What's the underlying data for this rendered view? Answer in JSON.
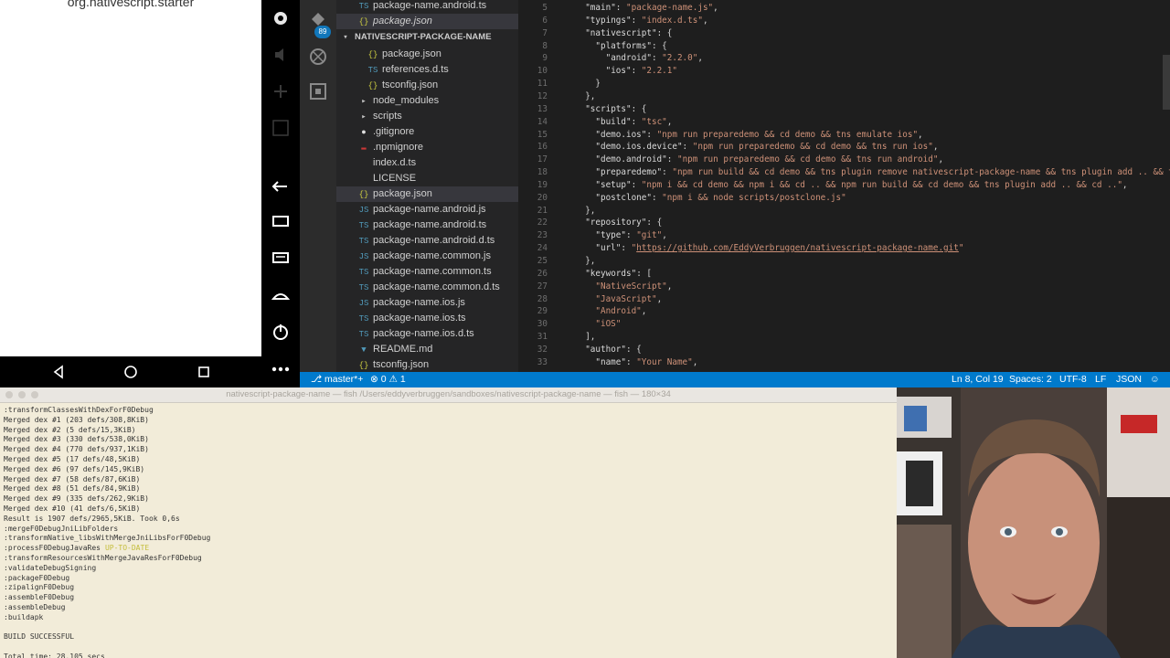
{
  "emulator": {
    "app_title": "org.nativescript.starter",
    "nav_icons": [
      "back-icon",
      "home-icon",
      "recents-icon",
      "more-icon"
    ],
    "side_icons": [
      "power-icon",
      "volume-up-icon",
      "volume-down-icon",
      "rotate-icon",
      "screenshot-icon",
      "zoom-icon",
      "back-icon",
      "overview-icon",
      "menu-icon",
      "home-icon",
      "power-icon",
      "more-icon"
    ]
  },
  "activity_bar": {
    "items": [
      "explorer-icon",
      "search-icon",
      "git-icon",
      "debug-icon",
      "extensions-icon"
    ],
    "git_badge": "89"
  },
  "explorer": {
    "items": [
      {
        "label": "package-name.android.ts",
        "icon": "TS",
        "kind": "ts",
        "indent": 1,
        "selected": false
      },
      {
        "label": "package.json",
        "icon": "{}",
        "kind": "json",
        "indent": 1,
        "selected": true,
        "italic": true
      },
      {
        "label": "NATIVESCRIPT-PACKAGE-NAME",
        "icon": "▾",
        "kind": "chev",
        "indent": 0,
        "selected": false,
        "header": true
      },
      {
        "label": "package.json",
        "icon": "{}",
        "kind": "json",
        "indent": 2,
        "selected": false
      },
      {
        "label": "references.d.ts",
        "icon": "TS",
        "kind": "ts",
        "indent": 2,
        "selected": false
      },
      {
        "label": "tsconfig.json",
        "icon": "{}",
        "kind": "json",
        "indent": 2,
        "selected": false
      },
      {
        "label": "node_modules",
        "icon": "▸",
        "kind": "chev",
        "indent": 1,
        "selected": false
      },
      {
        "label": "scripts",
        "icon": "▸",
        "kind": "chev",
        "indent": 1,
        "selected": false
      },
      {
        "label": ".gitignore",
        "icon": "●",
        "kind": "git",
        "indent": 1,
        "selected": false
      },
      {
        "label": ".npmignore",
        "icon": "▬",
        "kind": "npm",
        "indent": 1,
        "selected": false
      },
      {
        "label": "index.d.ts",
        "icon": "",
        "kind": "ts",
        "indent": 1,
        "selected": false
      },
      {
        "label": "LICENSE",
        "icon": "",
        "kind": "ts",
        "indent": 1,
        "selected": false
      },
      {
        "label": "package.json",
        "icon": "{}",
        "kind": "json",
        "indent": 1,
        "selected": true
      },
      {
        "label": "package-name.android.js",
        "icon": "JS",
        "kind": "js",
        "indent": 1,
        "selected": false
      },
      {
        "label": "package-name.android.ts",
        "icon": "TS",
        "kind": "ts",
        "indent": 1,
        "selected": false
      },
      {
        "label": "package-name.android.d.ts",
        "icon": "TS",
        "kind": "ts",
        "indent": 1,
        "selected": false
      },
      {
        "label": "package-name.common.js",
        "icon": "JS",
        "kind": "js",
        "indent": 1,
        "selected": false
      },
      {
        "label": "package-name.common.ts",
        "icon": "TS",
        "kind": "ts",
        "indent": 1,
        "selected": false
      },
      {
        "label": "package-name.common.d.ts",
        "icon": "TS",
        "kind": "ts",
        "indent": 1,
        "selected": false
      },
      {
        "label": "package-name.ios.js",
        "icon": "JS",
        "kind": "js",
        "indent": 1,
        "selected": false
      },
      {
        "label": "package-name.ios.ts",
        "icon": "TS",
        "kind": "ts",
        "indent": 1,
        "selected": false
      },
      {
        "label": "package-name.ios.d.ts",
        "icon": "TS",
        "kind": "ts",
        "indent": 1,
        "selected": false
      },
      {
        "label": "README.md",
        "icon": "▼",
        "kind": "md",
        "indent": 1,
        "selected": false
      },
      {
        "label": "tsconfig.json",
        "icon": "{}",
        "kind": "json",
        "indent": 1,
        "selected": false
      }
    ]
  },
  "editor": {
    "lines": [
      {
        "n": "5",
        "parts": [
          [
            "p",
            "  "
          ],
          [
            "k",
            "\"main\""
          ],
          [
            "p",
            ": "
          ],
          [
            "s",
            "\"package-name.js\""
          ],
          [
            "p",
            ","
          ]
        ]
      },
      {
        "n": "6",
        "parts": [
          [
            "p",
            "  "
          ],
          [
            "k",
            "\"typings\""
          ],
          [
            "p",
            ": "
          ],
          [
            "s",
            "\"index.d.ts\""
          ],
          [
            "p",
            ","
          ]
        ]
      },
      {
        "n": "7",
        "parts": [
          [
            "p",
            "  "
          ],
          [
            "k",
            "\"nativescript\""
          ],
          [
            "p",
            ": {"
          ]
        ]
      },
      {
        "n": "8",
        "parts": [
          [
            "p",
            "    "
          ],
          [
            "k",
            "\"platforms\""
          ],
          [
            "p",
            ": {"
          ]
        ]
      },
      {
        "n": "9",
        "parts": [
          [
            "p",
            "      "
          ],
          [
            "k",
            "\"android\""
          ],
          [
            "p",
            ": "
          ],
          [
            "s",
            "\"2.2.0\""
          ],
          [
            "p",
            ","
          ]
        ]
      },
      {
        "n": "10",
        "parts": [
          [
            "p",
            "      "
          ],
          [
            "k",
            "\"ios\""
          ],
          [
            "p",
            ": "
          ],
          [
            "s",
            "\"2.2.1\""
          ]
        ]
      },
      {
        "n": "11",
        "parts": [
          [
            "p",
            "    }"
          ]
        ]
      },
      {
        "n": "12",
        "parts": [
          [
            "p",
            "  },"
          ]
        ]
      },
      {
        "n": "13",
        "parts": [
          [
            "p",
            "  "
          ],
          [
            "k",
            "\"scripts\""
          ],
          [
            "p",
            ": {"
          ]
        ]
      },
      {
        "n": "14",
        "parts": [
          [
            "p",
            "    "
          ],
          [
            "k",
            "\"build\""
          ],
          [
            "p",
            ": "
          ],
          [
            "s",
            "\"tsc\""
          ],
          [
            "p",
            ","
          ]
        ]
      },
      {
        "n": "15",
        "parts": [
          [
            "p",
            "    "
          ],
          [
            "k",
            "\"demo.ios\""
          ],
          [
            "p",
            ": "
          ],
          [
            "s",
            "\"npm run preparedemo && cd demo && tns emulate ios\""
          ],
          [
            "p",
            ","
          ]
        ]
      },
      {
        "n": "16",
        "parts": [
          [
            "p",
            "    "
          ],
          [
            "k",
            "\"demo.ios.device\""
          ],
          [
            "p",
            ": "
          ],
          [
            "s",
            "\"npm run preparedemo && cd demo && tns run ios\""
          ],
          [
            "p",
            ","
          ]
        ]
      },
      {
        "n": "17",
        "parts": [
          [
            "p",
            "    "
          ],
          [
            "k",
            "\"demo.android\""
          ],
          [
            "p",
            ": "
          ],
          [
            "s",
            "\"npm run preparedemo && cd demo && tns run android\""
          ],
          [
            "p",
            ","
          ]
        ]
      },
      {
        "n": "18",
        "parts": [
          [
            "p",
            "    "
          ],
          [
            "k",
            "\"preparedemo\""
          ],
          [
            "p",
            ": "
          ],
          [
            "s",
            "\"npm run build && cd demo && tns plugin remove nativescript-package-name && tns plugin add .. && t"
          ]
        ]
      },
      {
        "n": "19",
        "parts": [
          [
            "p",
            "    "
          ],
          [
            "k",
            "\"setup\""
          ],
          [
            "p",
            ": "
          ],
          [
            "s",
            "\"npm i && cd demo && npm i && cd .. && npm run build && cd demo && tns plugin add .. && cd ..\""
          ],
          [
            "p",
            ","
          ]
        ]
      },
      {
        "n": "20",
        "parts": [
          [
            "p",
            "    "
          ],
          [
            "k",
            "\"postclone\""
          ],
          [
            "p",
            ": "
          ],
          [
            "s",
            "\"npm i && node scripts/postclone.js\""
          ]
        ]
      },
      {
        "n": "21",
        "parts": [
          [
            "p",
            "  },"
          ]
        ]
      },
      {
        "n": "22",
        "parts": [
          [
            "p",
            "  "
          ],
          [
            "k",
            "\"repository\""
          ],
          [
            "p",
            ": {"
          ]
        ]
      },
      {
        "n": "23",
        "parts": [
          [
            "p",
            "    "
          ],
          [
            "k",
            "\"type\""
          ],
          [
            "p",
            ": "
          ],
          [
            "s",
            "\"git\""
          ],
          [
            "p",
            ","
          ]
        ]
      },
      {
        "n": "24",
        "parts": [
          [
            "p",
            "    "
          ],
          [
            "k",
            "\"url\""
          ],
          [
            "p",
            ": "
          ],
          [
            "s",
            "\""
          ],
          [
            "u",
            "https://github.com/EddyVerbruggen/nativescript-package-name.git"
          ],
          [
            "s",
            "\""
          ]
        ]
      },
      {
        "n": "25",
        "parts": [
          [
            "p",
            "  },"
          ]
        ]
      },
      {
        "n": "26",
        "parts": [
          [
            "p",
            "  "
          ],
          [
            "k",
            "\"keywords\""
          ],
          [
            "p",
            ": ["
          ]
        ]
      },
      {
        "n": "27",
        "parts": [
          [
            "p",
            "    "
          ],
          [
            "s",
            "\"NativeScript\""
          ],
          [
            "p",
            ","
          ]
        ]
      },
      {
        "n": "28",
        "parts": [
          [
            "p",
            "    "
          ],
          [
            "s",
            "\"JavaScript\""
          ],
          [
            "p",
            ","
          ]
        ]
      },
      {
        "n": "29",
        "parts": [
          [
            "p",
            "    "
          ],
          [
            "s",
            "\"Android\""
          ],
          [
            "p",
            ","
          ]
        ]
      },
      {
        "n": "30",
        "parts": [
          [
            "p",
            "    "
          ],
          [
            "s",
            "\"iOS\""
          ]
        ]
      },
      {
        "n": "31",
        "parts": [
          [
            "p",
            "  ],"
          ]
        ]
      },
      {
        "n": "32",
        "parts": [
          [
            "p",
            "  "
          ],
          [
            "k",
            "\"author\""
          ],
          [
            "p",
            ": {"
          ]
        ]
      },
      {
        "n": "33",
        "parts": [
          [
            "p",
            "    "
          ],
          [
            "k",
            "\"name\""
          ],
          [
            "p",
            ": "
          ],
          [
            "s",
            "\"Your Name\""
          ],
          [
            "p",
            ","
          ]
        ]
      }
    ]
  },
  "status_bar": {
    "branch": "master*+",
    "errors": "0",
    "warnings": "1",
    "position": "Ln 8, Col 19",
    "spaces": "Spaces: 2",
    "encoding": "UTF-8",
    "eol": "LF",
    "language": "JSON"
  },
  "terminal": {
    "title": "nativescript-package-name — fish  /Users/eddyverbruggen/sandboxes/nativescript-package-name — fish — 180×34",
    "lines": [
      ":transformClassesWithDexForF0Debug",
      "Merged dex #1 (203 defs/308,8KiB)",
      "Merged dex #2 (5 defs/15,3KiB)",
      "Merged dex #3 (330 defs/538,0KiB)",
      "Merged dex #4 (770 defs/937,1KiB)",
      "Merged dex #5 (17 defs/48,5KiB)",
      "Merged dex #6 (97 defs/145,9KiB)",
      "Merged dex #7 (58 defs/87,6KiB)",
      "Merged dex #8 (51 defs/84,9KiB)",
      "Merged dex #9 (335 defs/262,9KiB)",
      "Merged dex #10 (41 defs/6,5KiB)",
      "Result is 1907 defs/2965,5KiB. Took 0,6s",
      ":mergeF0DebugJniLibFolders",
      ":transformNative_libsWithMergeJniLibsForF0Debug",
      ":processF0DebugJavaRes",
      ":transformResourcesWithMergeJavaResForF0Debug",
      ":validateDebugSigning",
      ":packageF0Debug",
      ":zipalignF0Debug",
      ":assembleF0Debug",
      ":assembleDebug",
      ":buildapk",
      "",
      "BUILD SUCCESSFUL",
      "",
      "Total time: 28.105 secs"
    ],
    "up_to_date": "UP-TO-DATE"
  }
}
